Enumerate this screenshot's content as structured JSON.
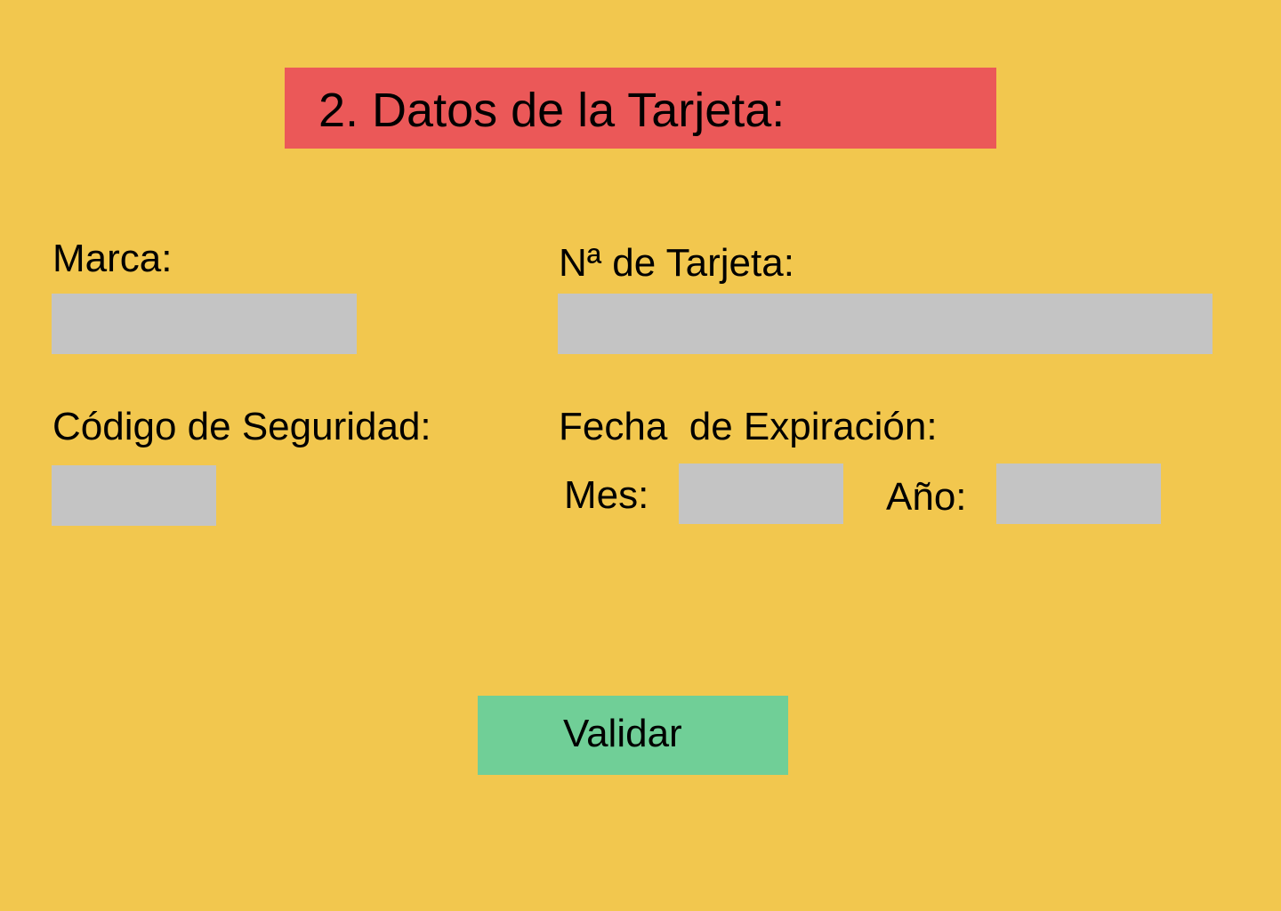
{
  "title": "2. Datos de la Tarjeta:",
  "fields": {
    "brand": {
      "label": "Marca:",
      "value": "",
      "placeholder": ""
    },
    "card_number": {
      "label": "Nª de Tarjeta:",
      "value": "",
      "placeholder": ""
    },
    "security_code": {
      "label": "Código de Seguridad:",
      "value": "",
      "placeholder": ""
    },
    "expiration": {
      "label": "Fecha  de Expiración:",
      "month": {
        "label": "Mes:",
        "value": "",
        "placeholder": ""
      },
      "year": {
        "label": "Año:",
        "value": "",
        "placeholder": ""
      }
    }
  },
  "submit_label": "Validar",
  "colors": {
    "background": "#F2C74E",
    "title_bar": "#EB5858",
    "field": "#C4C4C4",
    "button": "#70CF97"
  }
}
